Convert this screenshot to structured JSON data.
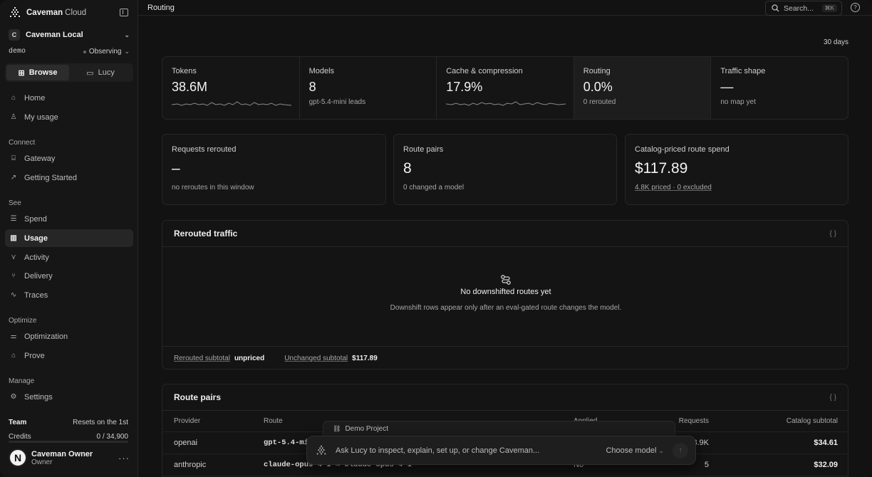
{
  "brand": {
    "name": "Caveman",
    "suffix": "Cloud"
  },
  "org": {
    "badge": "C",
    "name": "Caveman Local"
  },
  "env": {
    "name": "demo",
    "status": "Observing"
  },
  "switcher": {
    "browse": "Browse",
    "lucy": "Lucy"
  },
  "nav": {
    "home": "Home",
    "my_usage": "My usage",
    "connect": "Connect",
    "gateway": "Gateway",
    "getting_started": "Getting Started",
    "see": "See",
    "spend": "Spend",
    "usage": "Usage",
    "activity": "Activity",
    "delivery": "Delivery",
    "traces": "Traces",
    "optimize": "Optimize",
    "optimization": "Optimization",
    "prove": "Prove",
    "manage": "Manage",
    "settings": "Settings"
  },
  "team": {
    "label": "Team",
    "resets": "Resets on the 1st",
    "credits_label": "Credits",
    "credits_value": "0 / 34,900",
    "credits_used_fraction": 0
  },
  "user": {
    "initial": "N",
    "name": "Caveman Owner",
    "role": "Owner"
  },
  "topbar": {
    "title": "Routing",
    "search_placeholder": "Search...",
    "shortcut": "⌘K"
  },
  "range": "30 days",
  "metrics": [
    {
      "label": "Tokens",
      "value": "38.6M",
      "sub": ""
    },
    {
      "label": "Models",
      "value": "8",
      "sub": "gpt-5.4-mini leads"
    },
    {
      "label": "Cache & compression",
      "value": "17.9%",
      "sub": ""
    },
    {
      "label": "Routing",
      "value": "0.0%",
      "sub": "0 rerouted"
    },
    {
      "label": "Traffic shape",
      "value": "—",
      "sub": "no map yet"
    }
  ],
  "cards": [
    {
      "label": "Requests rerouted",
      "value": "–",
      "sub": "no reroutes in this window"
    },
    {
      "label": "Route pairs",
      "value": "8",
      "sub": "0 changed a model"
    },
    {
      "label": "Catalog-priced route spend",
      "value": "$117.89",
      "sub": "4.8K priced · 0 excluded"
    }
  ],
  "rerouted": {
    "title": "Rerouted traffic",
    "empty_title": "No downshifted routes yet",
    "empty_desc": "Downshift rows appear only after an eval-gated route changes the model.",
    "rerouted_subtotal_label": "Rerouted subtotal",
    "rerouted_subtotal_value": "unpriced",
    "unchanged_subtotal_label": "Unchanged subtotal",
    "unchanged_subtotal_value": "$117.89"
  },
  "route_pairs": {
    "title": "Route pairs",
    "columns": {
      "provider": "Provider",
      "route": "Route",
      "applied": "Applied",
      "requests": "Requests",
      "subtotal": "Catalog subtotal"
    },
    "rows": [
      {
        "provider": "openai",
        "route": "gpt-5.4-mir",
        "applied": "",
        "requests": "3.9K",
        "subtotal": "$34.61"
      },
      {
        "provider": "anthropic",
        "route": "claude-opus-4-1 → claude-opus-4-1",
        "applied": "No",
        "requests": "5",
        "subtotal": "$32.09"
      }
    ]
  },
  "lucy": {
    "project": "Demo Project",
    "placeholder": "Ask Lucy to inspect, explain, set up, or change Caveman...",
    "model": "Choose model"
  }
}
